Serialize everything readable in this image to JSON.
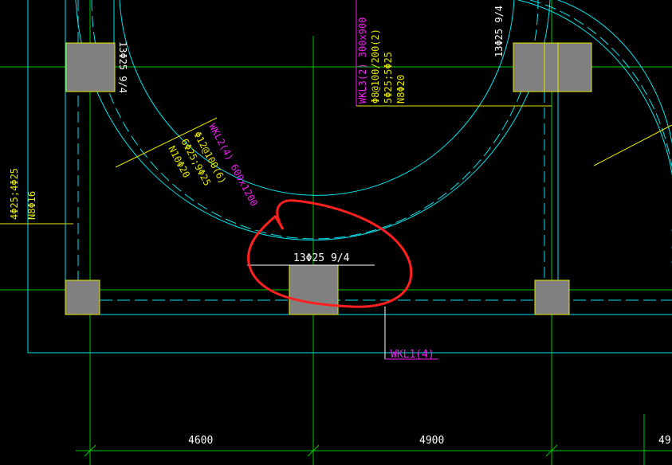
{
  "colors": {
    "background": "#000000",
    "grid": "#00c800",
    "outline": "#00e5ee",
    "column": "#808080",
    "column_edge": "#e6e600",
    "label_yellow": "#e6e600",
    "label_white": "#ffffff",
    "label_magenta": "#ee22ee",
    "markup": "#ff2020"
  },
  "labels": {
    "col_top_left": "13Φ25 9/4",
    "col_top_right": "13Φ25 9/4",
    "col_center": "13Φ25 9/4",
    "wkl3_title": "WKL3(2) 300x900",
    "wkl3_stirrup": "Φ8@100/200(2)",
    "wkl3_bars": "5Φ25;5Φ25",
    "wkl3_side": "N8Φ20",
    "wkl2_title": "WKL2(4) 600x1200",
    "wkl2_stirrup": "Φ12@100(6)",
    "wkl2_bars": "6Φ25;9Φ25",
    "wkl2_side": "N10Φ20",
    "left_bars": "4Φ25;4Φ25",
    "left_side": "N8Φ16",
    "wkl1_title": "WKL1(4)",
    "dim_1": "4600",
    "dim_2": "4900",
    "dim_3": "49"
  }
}
